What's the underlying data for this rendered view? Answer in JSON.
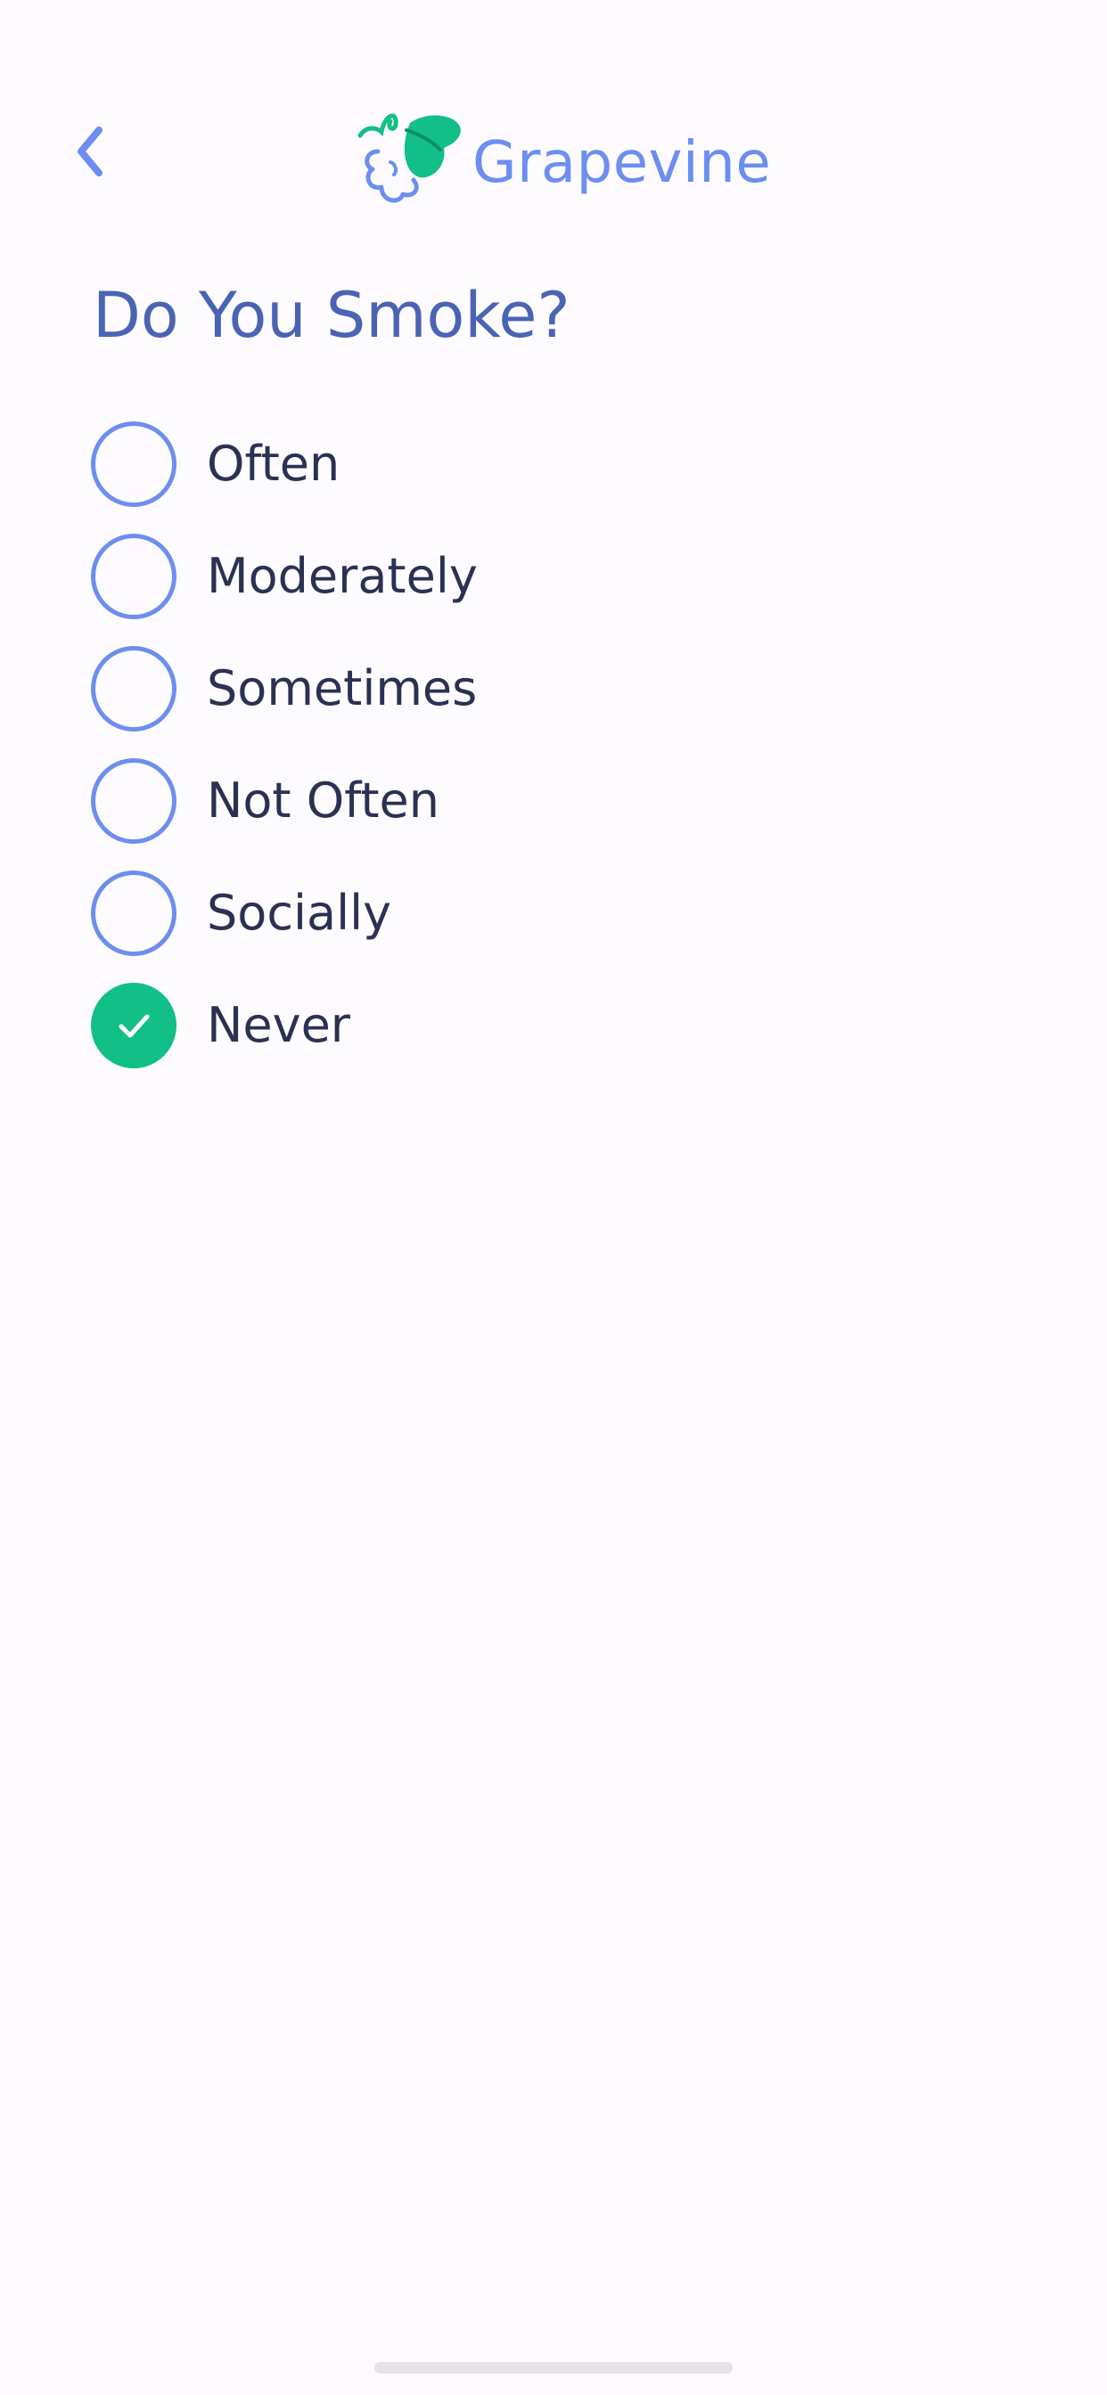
{
  "header": {
    "back_icon": "chevron-left-icon",
    "logo_icon": "grape-logo-icon",
    "brand_name": "Grapevine",
    "brand_color": "#6c8ef0",
    "brand_accent": "#12bf86"
  },
  "page": {
    "title": "Do You Smoke?"
  },
  "options": [
    {
      "label": "Often",
      "selected": false
    },
    {
      "label": "Moderately",
      "selected": false
    },
    {
      "label": "Sometimes",
      "selected": false
    },
    {
      "label": "Not Often",
      "selected": false
    },
    {
      "label": "Socially",
      "selected": false
    },
    {
      "label": "Never",
      "selected": true
    }
  ],
  "colors": {
    "background": "#fefbfe",
    "title": "#4a64b4",
    "radio_border": "#6c8ef0",
    "radio_selected": "#12bf86",
    "option_text": "#2b3152"
  }
}
